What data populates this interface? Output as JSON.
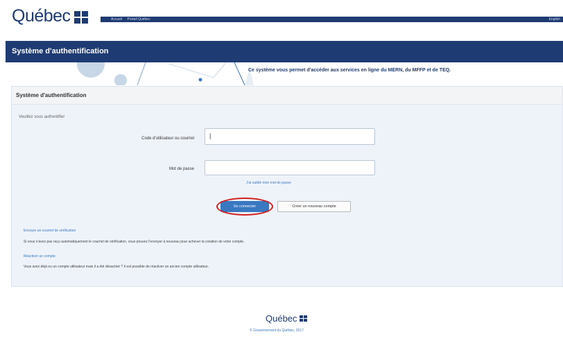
{
  "header": {
    "logo_text": "Québec",
    "links": [
      "Accueil",
      "Portail Québec"
    ],
    "lang": "English"
  },
  "banner": {
    "title": "Système d'authentification"
  },
  "hero": {
    "text": "Ce système vous permet d'accéder aux services en ligne du MERN, du MFFP et de TEQ."
  },
  "panel": {
    "title": "Système d'authentification",
    "intro": "Veuillez vous authentifier",
    "username_label": "Code d'utilisateur ou courriel",
    "username_value": "|",
    "password_label": "Mot de passe",
    "forgot_link": "J'ai oublié mon mot de passe",
    "login_button": "Se connecter",
    "create_button": "Créer un nouveau compte",
    "resend_link": "Envoyer un courriel de vérification",
    "resend_text": "Si vous n'avez pas reçu automatiquement le courriel de vérification, vous pouvez l'envoyer à nouveau pour achever la création de votre compte.",
    "reactivate_link": "Réactiver un compte",
    "reactivate_text": "Vous avez déjà eu un compte utilisateur mais il a été désactivé ? Il est possible de réactiver un ancien compte utilisateur."
  },
  "footer": {
    "logo_text": "Québec",
    "copyright": "© Gouvernement du Québec, 2017"
  },
  "colors": {
    "brand": "#1f3b73",
    "accent": "#3a78c2",
    "highlight": "#d11f1f"
  }
}
